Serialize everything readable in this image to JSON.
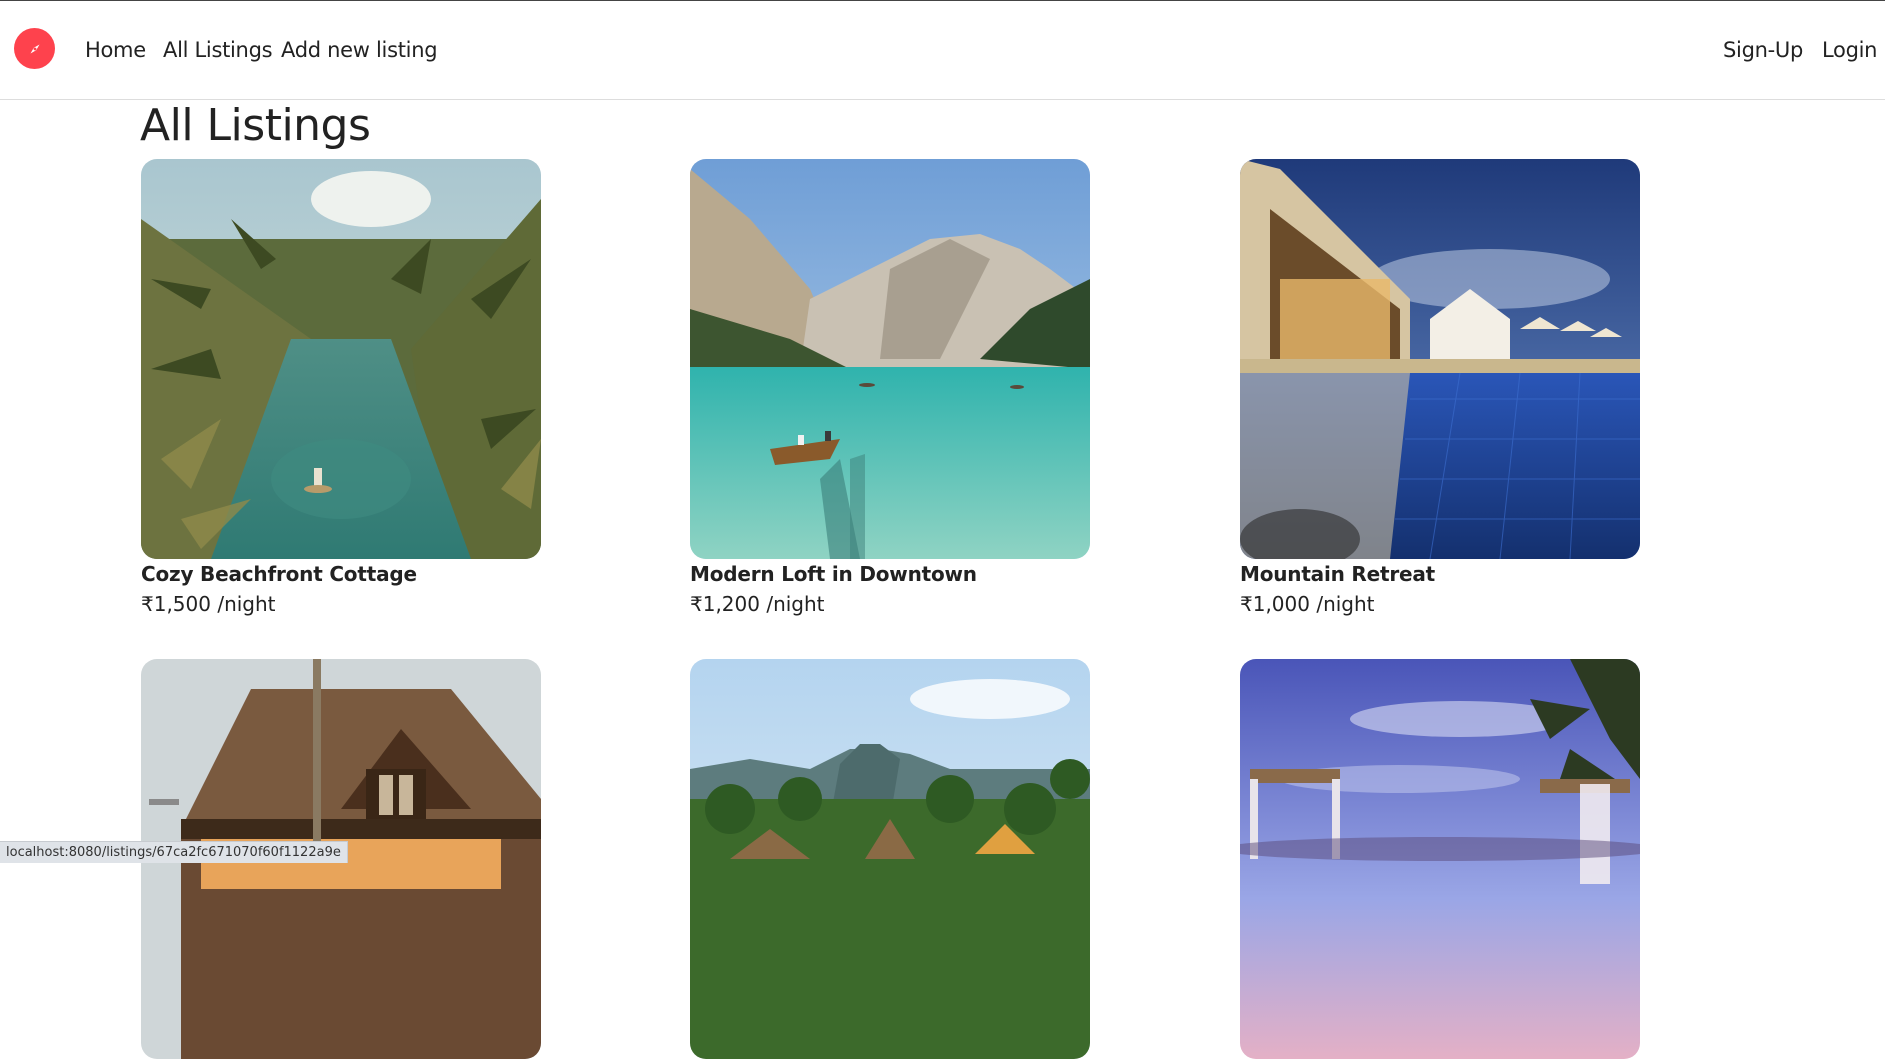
{
  "nav": {
    "brand_icon": "compass-icon",
    "links": {
      "home": "Home",
      "all_listings": "All Listings",
      "add_new": "Add new listing"
    },
    "auth": {
      "signup": "Sign-Up",
      "login": "Login"
    }
  },
  "page": {
    "title": "All Listings"
  },
  "listings": [
    {
      "title": "Cozy Beachfront Cottage",
      "price": "₹1,500 /night",
      "image": "tropical-canal-photo"
    },
    {
      "title": "Modern Loft in Downtown",
      "price": "₹1,200 /night",
      "image": "alpine-lake-boat-photo"
    },
    {
      "title": "Mountain Retreat",
      "price": "₹1,000 /night",
      "image": "resort-pool-night-photo"
    },
    {
      "title": "",
      "price": "",
      "image": "wooden-lodge-photo"
    },
    {
      "title": "",
      "price": "",
      "image": "tropical-village-mountain-photo"
    },
    {
      "title": "",
      "price": "",
      "image": "beach-cabana-sunset-photo"
    }
  ],
  "status_bar": {
    "url": "localhost:8080/listings/67ca2fc671070f60f1122a9e"
  },
  "colors": {
    "brand": "#fe424d",
    "text": "#222222",
    "border": "#dddddd"
  }
}
